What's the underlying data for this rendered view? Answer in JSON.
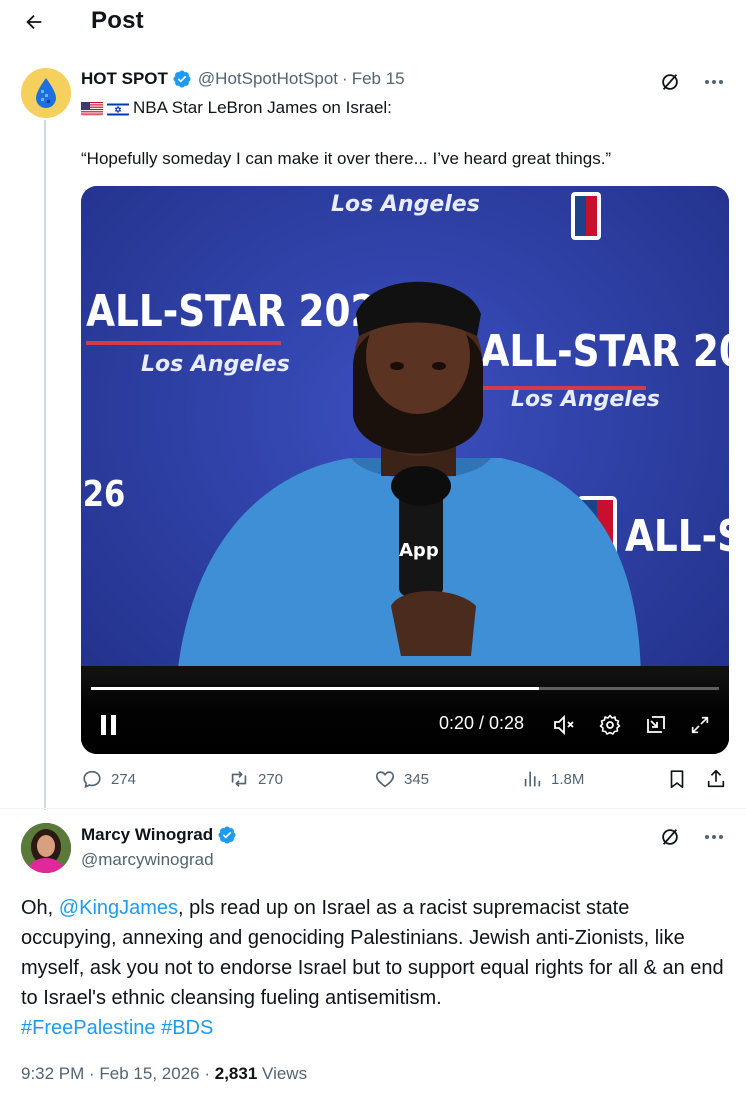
{
  "header": {
    "title": "Post",
    "back_icon": "arrow-left-icon"
  },
  "post": {
    "author_name": "HOT SPOT",
    "handle": "@HotSpotHotSpot",
    "separator": "·",
    "date": "Feb 15",
    "flags": [
      "us-flag-icon",
      "israel-flag-icon"
    ],
    "line1": "NBA Star LeBron James on Israel:",
    "line2": "“Hopefully someday I can make it over there... I’ve heard great things.”",
    "video": {
      "time": "0:20 / 0:28",
      "progress_fraction": 0.714,
      "backdrop_text": [
        "ALL-STAR 2026",
        "Los Angeles",
        "NBA",
        "App"
      ]
    },
    "actions": {
      "replies": "274",
      "reposts": "270",
      "likes": "345",
      "views": "1.8M"
    }
  },
  "reply": {
    "author_name": "Marcy Winograd",
    "handle": "@marcywinograd",
    "text_pre": "Oh, ",
    "mention": "@KingJames",
    "text_post": ", pls read up on Israel as a racist supremacist state occupying, annexing and genociding Palestinians. Jewish anti-Zionists, like myself, ask you not to endorse Israel but to support equal rights for all & an end to Israel's ethnic cleansing fueling antisemitism.",
    "hashtag1": "#FreePalestine",
    "hashtag2": "#BDS",
    "timestamp": "9:32 PM · Feb 15, 2026",
    "separator": "·",
    "views_count": "2,831",
    "views_label": "Views"
  },
  "colors": {
    "accent": "#1d9bf0",
    "muted": "#536471",
    "text": "#0f1419",
    "video_bg": "#2c3d9c"
  }
}
